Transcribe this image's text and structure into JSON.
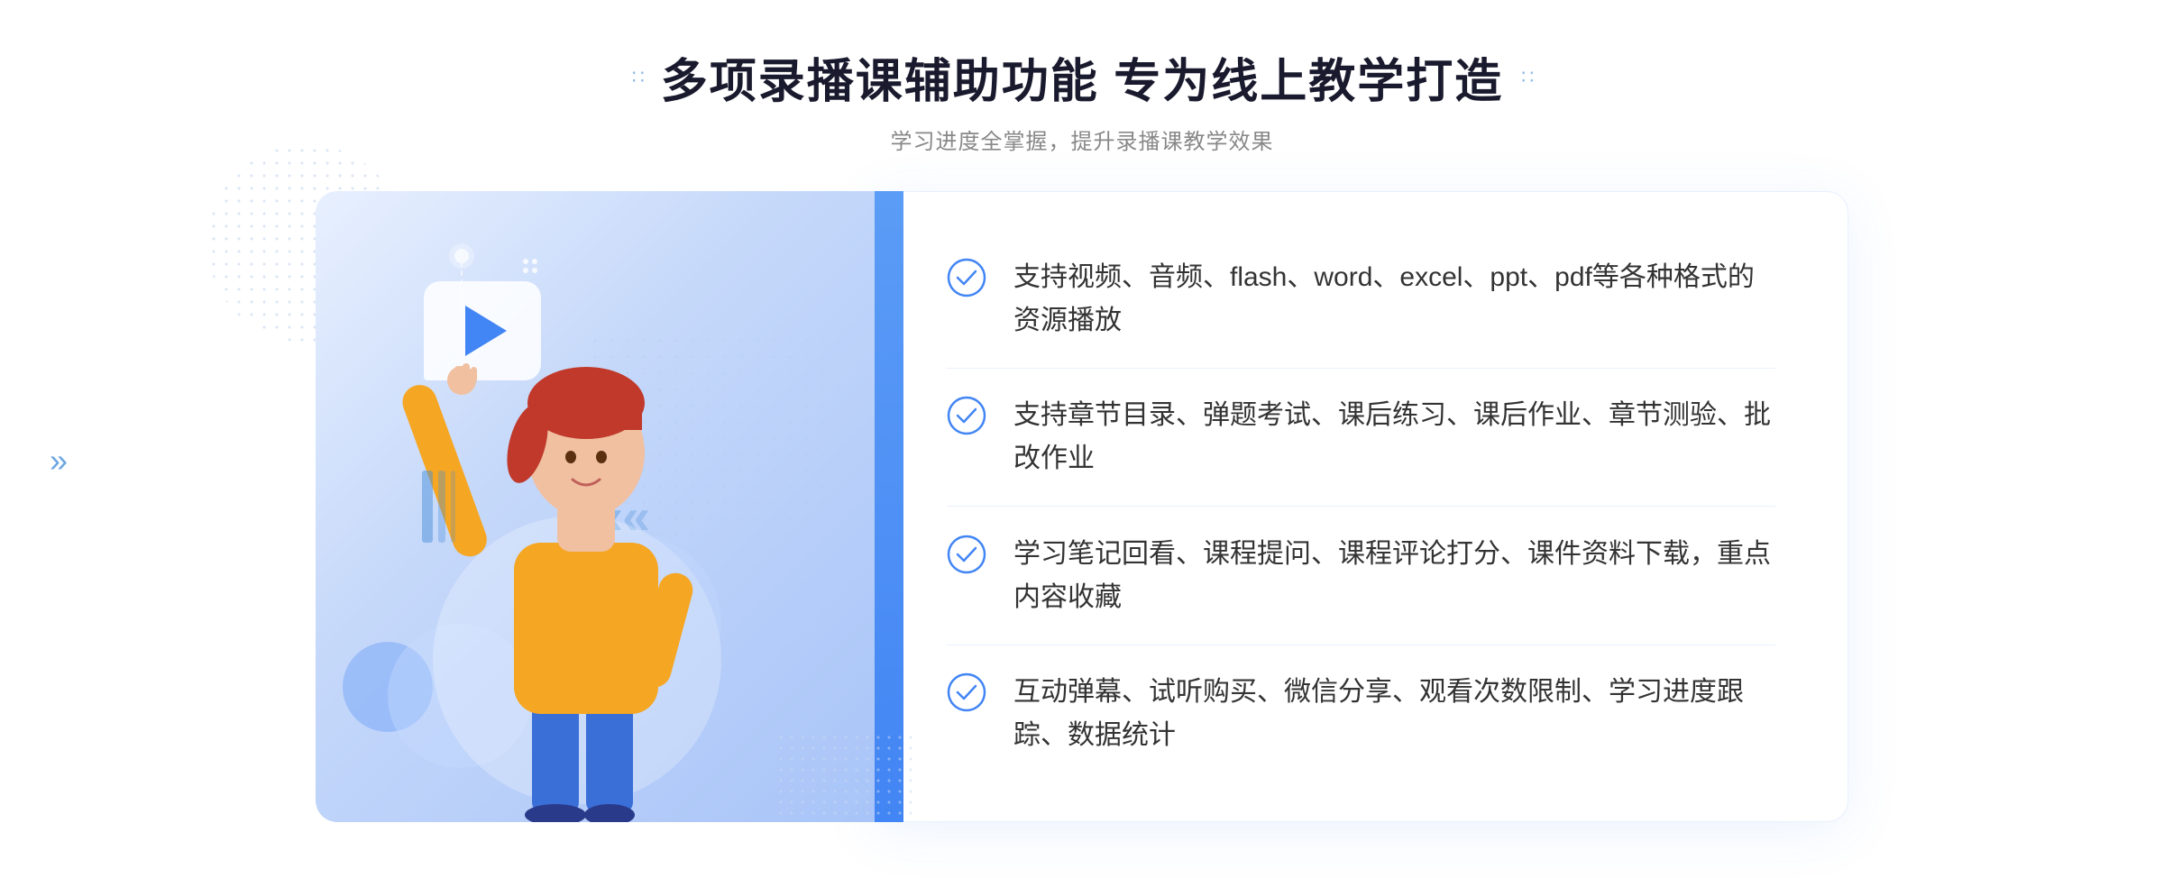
{
  "header": {
    "title": "多项录播课辅助功能 专为线上教学打造",
    "subtitle": "学习进度全掌握，提升录播课教学效果",
    "dots_left": "∷",
    "dots_right": "∷"
  },
  "features": [
    {
      "id": 1,
      "text": "支持视频、音频、flash、word、excel、ppt、pdf等各种格式的资源播放"
    },
    {
      "id": 2,
      "text": "支持章节目录、弹题考试、课后练习、课后作业、章节测验、批改作业"
    },
    {
      "id": 3,
      "text": "学习笔记回看、课程提问、课程评论打分、课件资料下载，重点内容收藏"
    },
    {
      "id": 4,
      "text": "互动弹幕、试听购买、微信分享、观看次数限制、学习进度跟踪、数据统计"
    }
  ],
  "chevron": "»",
  "colors": {
    "primary_blue": "#4285f4",
    "light_blue": "#e8f0fe",
    "text_dark": "#1a1a2e",
    "text_gray": "#888888",
    "text_body": "#333333"
  }
}
